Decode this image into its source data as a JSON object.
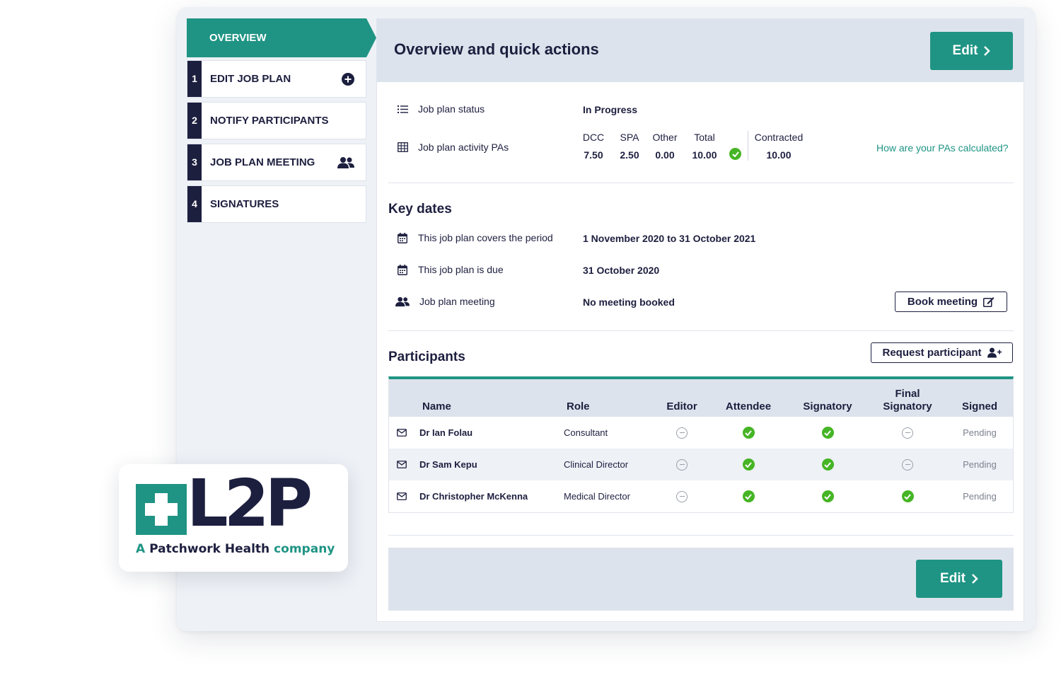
{
  "sidebar": {
    "overview": "OVERVIEW",
    "steps": [
      {
        "num": "1",
        "label": "EDIT JOB PLAN",
        "icon": "plus-circle-icon"
      },
      {
        "num": "2",
        "label": "NOTIFY PARTICIPANTS",
        "icon": ""
      },
      {
        "num": "3",
        "label": "JOB PLAN MEETING",
        "icon": "users-icon"
      },
      {
        "num": "4",
        "label": "SIGNATURES",
        "icon": ""
      }
    ]
  },
  "header": {
    "title": "Overview and quick actions",
    "edit_label": "Edit"
  },
  "status": {
    "label": "Job plan status",
    "value": "In Progress"
  },
  "activity": {
    "label": "Job plan activity PAs",
    "columns": [
      {
        "head": "DCC",
        "value": "7.50"
      },
      {
        "head": "SPA",
        "value": "2.50"
      },
      {
        "head": "Other",
        "value": "0.00"
      },
      {
        "head": "Total",
        "value": "10.00"
      }
    ],
    "contracted_head": "Contracted",
    "contracted_value": "10.00",
    "help_link": "How are your PAs calculated?"
  },
  "key_dates": {
    "title": "Key dates",
    "period_label": "This job plan covers the period",
    "period_value": "1 November 2020 to 31 October 2021",
    "due_label": "This job plan is due",
    "due_value": "31 October 2020",
    "meeting_label": "Job plan meeting",
    "meeting_value": "No meeting booked",
    "book_button": "Book meeting"
  },
  "participants": {
    "title": "Participants",
    "request_button": "Request participant",
    "headers": {
      "name": "Name",
      "role": "Role",
      "editor": "Editor",
      "attendee": "Attendee",
      "signatory": "Signatory",
      "final_signatory_1": "Final",
      "final_signatory_2": "Signatory",
      "signed": "Signed"
    },
    "rows": [
      {
        "name": "Dr Ian Folau",
        "role": "Consultant",
        "editor": false,
        "attendee": true,
        "signatory": true,
        "final": false,
        "signed": "Pending"
      },
      {
        "name": "Dr Sam Kepu",
        "role": "Clinical Director",
        "editor": false,
        "attendee": true,
        "signatory": true,
        "final": false,
        "signed": "Pending"
      },
      {
        "name": "Dr Christopher McKenna",
        "role": "Medical Director",
        "editor": false,
        "attendee": true,
        "signatory": true,
        "final": true,
        "signed": "Pending"
      }
    ]
  },
  "footer": {
    "edit_label": "Edit"
  },
  "logo": {
    "mark": "L2P",
    "tagline_a": "A",
    "tagline_b": "Patchwork Health",
    "tagline_c": "company"
  },
  "colors": {
    "teal": "#1f9484",
    "navy": "#1d1f3f",
    "check_green": "#46b525"
  }
}
